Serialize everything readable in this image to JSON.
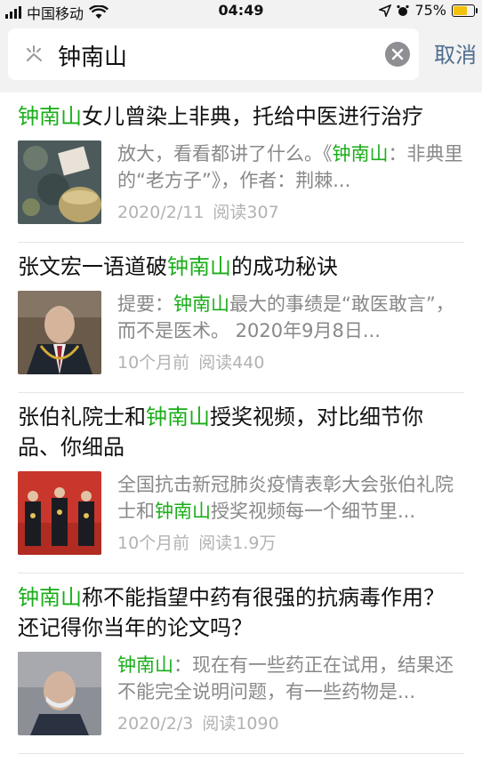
{
  "status_bar": {
    "carrier": "中国移动",
    "time": "04:49",
    "battery": "75%",
    "battery_level": 0.75,
    "colors": {
      "battery": "#f4c20d"
    }
  },
  "search": {
    "query": "钟南山",
    "cancel_label": "取消"
  },
  "colors": {
    "highlight": "#1aad19",
    "link": "#4f6d8f",
    "meta": "#b2b2b2"
  },
  "results": [
    {
      "title_pre": "",
      "title_hl": "钟南山",
      "title_post": "女儿曾染上非典，托给中医进行治疗",
      "snippet_pre": "放大，看看都讲了什么。《",
      "snippet_hl": "钟南山",
      "snippet_post": "：非典里的“老方子”》，作者：荆棘...",
      "date": "2020/2/11",
      "reads": "阅读307"
    },
    {
      "title_pre": "张文宏一语道破",
      "title_hl": "钟南山",
      "title_post": "的成功秘诀",
      "snippet_pre": "提要：",
      "snippet_hl": "钟南山",
      "snippet_post": "最大的事绩是“敢医敢言”，而不是医术。 2020年9月8日...",
      "date": "10个月前",
      "reads": "阅读440"
    },
    {
      "title_pre": "张伯礼院士和",
      "title_hl": "钟南山",
      "title_post": "授奖视频，对比细节你品、你细品",
      "snippet_pre": "全国抗击新冠肺炎疫情表彰大会张伯礼院士和",
      "snippet_hl": "钟南山",
      "snippet_post": "授奖视频每一个细节里...",
      "date": "10个月前",
      "reads": "阅读1.9万"
    },
    {
      "title_pre": "",
      "title_hl": "钟南山",
      "title_post": "称不能指望中药有很强的抗病毒作用？还记得你当年的论文吗？",
      "snippet_pre": "",
      "snippet_hl": "钟南山",
      "snippet_post": "：现在有一些药正在试用，结果还不能完全说明问题，有一些药物是...",
      "date": "2020/2/3",
      "reads": "阅读1090"
    }
  ]
}
